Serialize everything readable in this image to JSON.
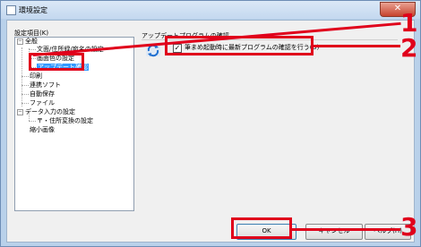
{
  "window": {
    "title": "環境設定",
    "close_glyph": "✕"
  },
  "tree": {
    "label": "設定項目(K)",
    "nodes": [
      {
        "label": "全般",
        "expander": "－"
      },
      {
        "label": "文面/住所録/宛名の設定"
      },
      {
        "label": "画面色の設定"
      },
      {
        "label": "アップデート確認",
        "selected": true
      },
      {
        "label": "印刷"
      },
      {
        "label": "連携ソフト"
      },
      {
        "label": "自動保存"
      },
      {
        "label": "ファイル"
      },
      {
        "label": "データ入力の設定",
        "expander": "－"
      },
      {
        "label": "〒・住所変換の設定"
      },
      {
        "label": "縮小画像"
      }
    ]
  },
  "section": {
    "title": "アップデートプログラムの確認",
    "checkbox_label": "筆まめ起動時に最新プログラムの確認を行う(U)",
    "checkbox_checked": true,
    "checkbox_mark": "✓"
  },
  "buttons": {
    "ok": "OK",
    "cancel": "キャンセル",
    "help": "ヘルプ(H)"
  },
  "callouts": {
    "one": "1",
    "two": "2",
    "three": "3"
  },
  "colors": {
    "callout": "#e0001b",
    "selection": "#3399ff"
  }
}
